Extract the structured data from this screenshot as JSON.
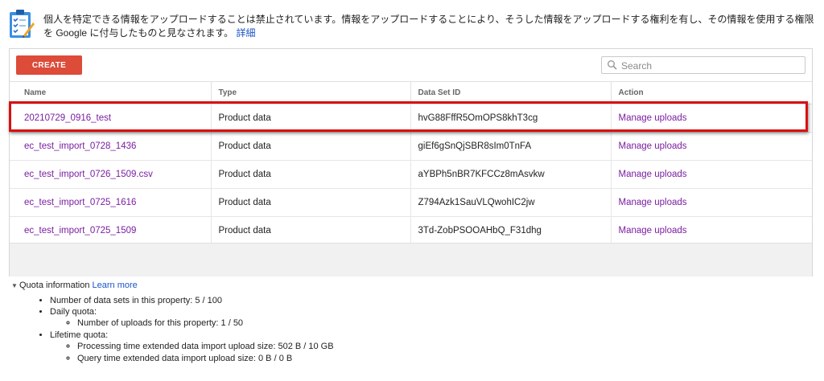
{
  "notice": {
    "text": "個人を特定できる情報をアップロードすることは禁止されています。情報をアップロードすることにより、そうした情報をアップロードする権利を有し、その情報を使用する権限を Google に付与したものと見なされます。",
    "link": "詳細",
    "icon": "clipboard-checklist-icon"
  },
  "toolbar": {
    "create_label": "CREATE",
    "create_color": "#dd4b39",
    "search_placeholder": "Search"
  },
  "table": {
    "headers": {
      "name": "Name",
      "type": "Type",
      "dataset_id": "Data Set ID",
      "action": "Action"
    },
    "rows": [
      {
        "name": "20210729_0916_test",
        "type": "Product data",
        "id": "hvG88FffR5OmOPS8khT3cg",
        "action": "Manage uploads"
      },
      {
        "name": "ec_test_import_0728_1436",
        "type": "Product data",
        "id": "giEf6gSnQjSBR8sIm0TnFA",
        "action": "Manage uploads"
      },
      {
        "name": "ec_test_import_0726_1509.csv",
        "type": "Product data",
        "id": "aYBPh5nBR7KFCCz8mAsvkw",
        "action": "Manage uploads"
      },
      {
        "name": "ec_test_import_0725_1616",
        "type": "Product data",
        "id": "Z794Azk1SauVLQwohIC2jw",
        "action": "Manage uploads"
      },
      {
        "name": "ec_test_import_0725_1509",
        "type": "Product data",
        "id": "3Td-ZobPSOOAHbQ_F31dhg",
        "action": "Manage uploads"
      }
    ],
    "highlight_color": "#d91010"
  },
  "quota": {
    "title": "Quota information",
    "learn_more": "Learn more",
    "data_sets": "Number of data sets in this property: 5 / 100",
    "daily_label": "Daily quota:",
    "uploads": "Number of uploads for this property: 1 / 50",
    "lifetime_label": "Lifetime quota:",
    "processing": "Processing time extended data import upload size: 502 B / 10 GB",
    "query": "Query time extended data import upload size: 0 B / 0 B"
  }
}
